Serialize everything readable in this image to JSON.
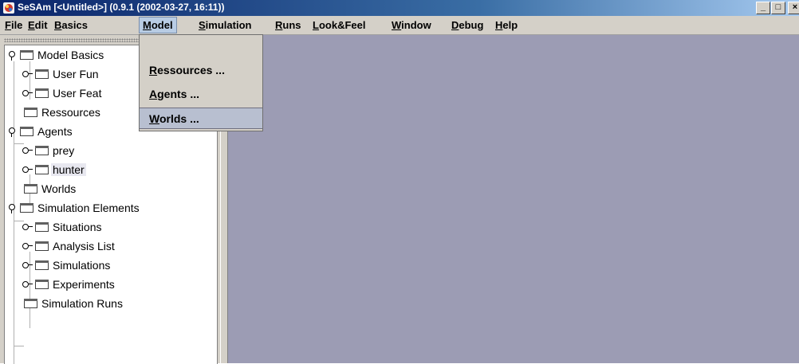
{
  "window": {
    "title": "SeSAm [<Untitled>] (0.9.1 (2002-03-27, 16:11))",
    "buttons": [
      "_",
      "□",
      "×"
    ]
  },
  "menubar": {
    "items": [
      {
        "first": "F",
        "rest": "ile"
      },
      {
        "first": "E",
        "rest": "dit"
      },
      {
        "first": "B",
        "rest": "asics"
      },
      {
        "first": "M",
        "rest": "odel"
      },
      {
        "first": "S",
        "rest": "imulation"
      },
      {
        "first": "R",
        "rest": "uns"
      },
      {
        "first": "L",
        "rest": "ook&Feel"
      },
      {
        "first": "W",
        "rest": "indow"
      },
      {
        "first": "D",
        "rest": "ebug"
      },
      {
        "first": "H",
        "rest": "elp"
      }
    ],
    "active": "Model"
  },
  "model_menu": {
    "items": [
      {
        "first": "R",
        "rest": "essources ..."
      },
      {
        "first": "A",
        "rest": "gents ..."
      },
      {
        "first": "W",
        "rest": "orlds ..."
      }
    ],
    "highlighted": "Worlds ..."
  },
  "tree": {
    "nodes": [
      "Model Basics",
      "User Fun",
      "User Feat",
      "Ressources",
      "Agents",
      "prey",
      "hunter",
      "Worlds",
      "Simulation Elements",
      "Situations",
      "Analysis List",
      "Simulations",
      "Experiments",
      "Simulation Runs"
    ],
    "selected": "hunter"
  },
  "colors": {
    "title_start": "#0a246a",
    "title_end": "#a6caf0",
    "chrome": "#d4d0c8",
    "desktop": "#9c9cb4",
    "menu_highlight": "#b8cce4"
  },
  "icons": {
    "app": "sesam-app-icon",
    "folder": "folder-icon",
    "expanded": "expanded-handle-icon",
    "collapsed": "collapsed-handle-icon"
  }
}
